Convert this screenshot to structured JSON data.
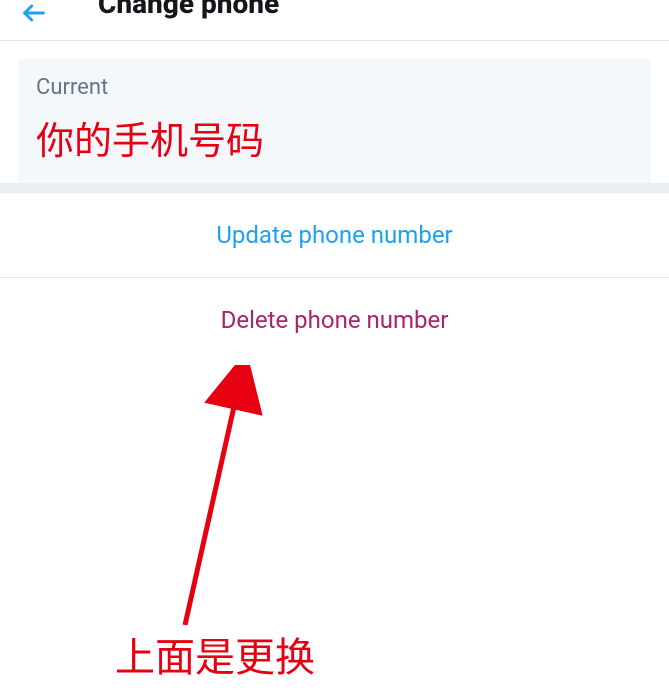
{
  "header": {
    "title": "Change phone"
  },
  "current": {
    "label": "Current",
    "value": "你的手机号码"
  },
  "actions": {
    "update": "Update phone number",
    "delete": "Delete phone number"
  },
  "annotation": {
    "text": "上面是更换"
  },
  "colors": {
    "accent": "#1da1f2",
    "danger": "#a8256c",
    "annotation": "#e60012"
  }
}
